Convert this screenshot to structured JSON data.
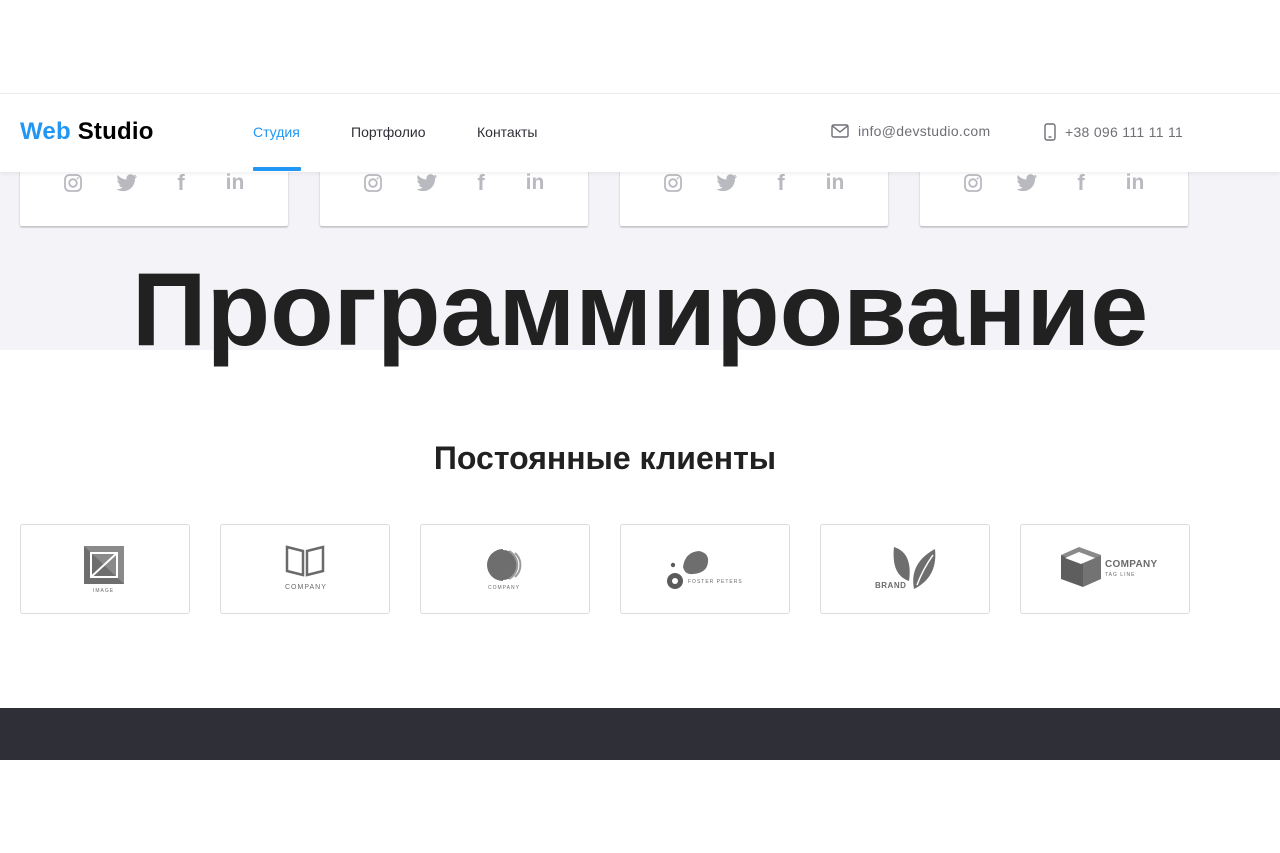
{
  "logo": {
    "part1": "Web",
    "part2": "Studio"
  },
  "nav": [
    {
      "label": "Студия",
      "active": true
    },
    {
      "label": "Портфолио",
      "active": false
    },
    {
      "label": "Контакты",
      "active": false
    }
  ],
  "contacts": {
    "email": "info@devstudio.com",
    "phone": "+38 096 111 11 11"
  },
  "team_cards": {
    "socials": [
      "instagram-icon",
      "twitter-icon",
      "facebook-icon",
      "linkedin-icon"
    ],
    "facebook_glyph": "f",
    "linkedin_glyph": "in"
  },
  "overlay_title": "Программирование",
  "clients": {
    "title": "Постоянные клиенты",
    "logos": [
      {
        "name": "image-logo",
        "text": "IMAGE"
      },
      {
        "name": "company-book-logo",
        "text": "COMPANY"
      },
      {
        "name": "company-circle-logo",
        "text": "COMPANY"
      },
      {
        "name": "foster-peters-logo",
        "text": "FOSTER PETERS"
      },
      {
        "name": "brand-leaf-logo",
        "text": "BRAND"
      },
      {
        "name": "company-cube-logo",
        "text": "COMPANY",
        "tagline": "TAG LINE"
      }
    ]
  },
  "colors": {
    "accent": "#2196f3",
    "text_dark": "#212121",
    "footer_bg": "#2f2f37",
    "team_bg": "#f4f4f8",
    "icon_gray": "#b9b9c0"
  }
}
